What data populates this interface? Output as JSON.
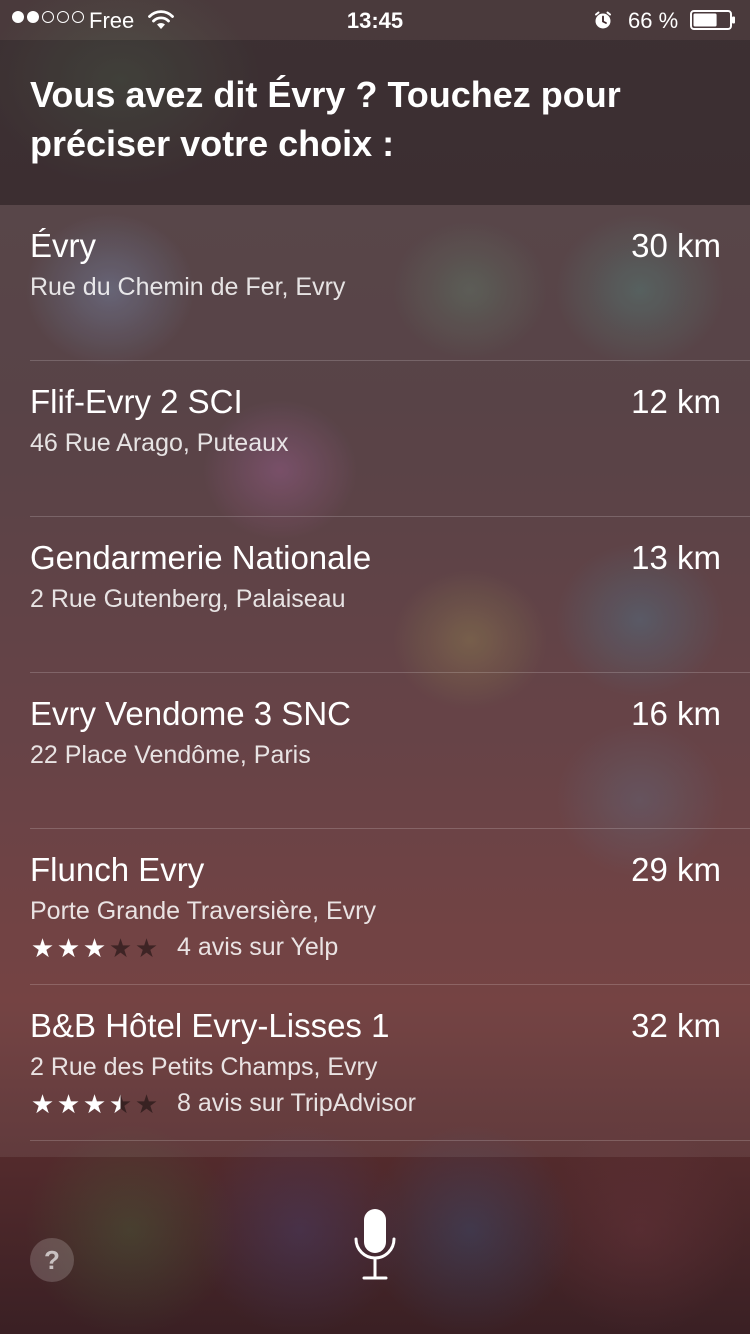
{
  "status_bar": {
    "signal": {
      "filled": 2,
      "total": 5
    },
    "carrier": "Free",
    "wifi_icon": "wifi-icon",
    "time": "13:45",
    "alarm_icon": "alarm-icon",
    "battery_percent": "66 %",
    "battery_level": 0.66
  },
  "siri": {
    "prompt": "Vous avez dit Évry ? Touchez pour préciser votre choix :"
  },
  "results": [
    {
      "name": "Évry",
      "address": "Rue du Chemin de Fer, Evry",
      "distance": "30 km"
    },
    {
      "name": "Flif-Evry 2 SCI",
      "address": "46 Rue Arago, Puteaux",
      "distance": "12 km"
    },
    {
      "name": "Gendarmerie Nationale",
      "address": "2 Rue Gutenberg, Palaiseau",
      "distance": "13 km"
    },
    {
      "name": "Evry Vendome 3 SNC",
      "address": "22 Place Vendôme, Paris",
      "distance": "16 km"
    },
    {
      "name": "Flunch Evry",
      "address": "Porte Grande Traversière, Evry",
      "distance": "29 km",
      "rating": 3,
      "rating_max": 5,
      "reviews": "4 avis sur Yelp"
    },
    {
      "name": "B&B Hôtel Evry-Lisses 1",
      "address": "2 Rue des Petits Champs, Evry",
      "distance": "32 km",
      "rating": 3.5,
      "rating_max": 5,
      "reviews": "8 avis sur TripAdvisor"
    }
  ],
  "bottom_bar": {
    "help_label": "?",
    "help_icon": "question-icon",
    "mic_icon": "microphone-icon"
  }
}
